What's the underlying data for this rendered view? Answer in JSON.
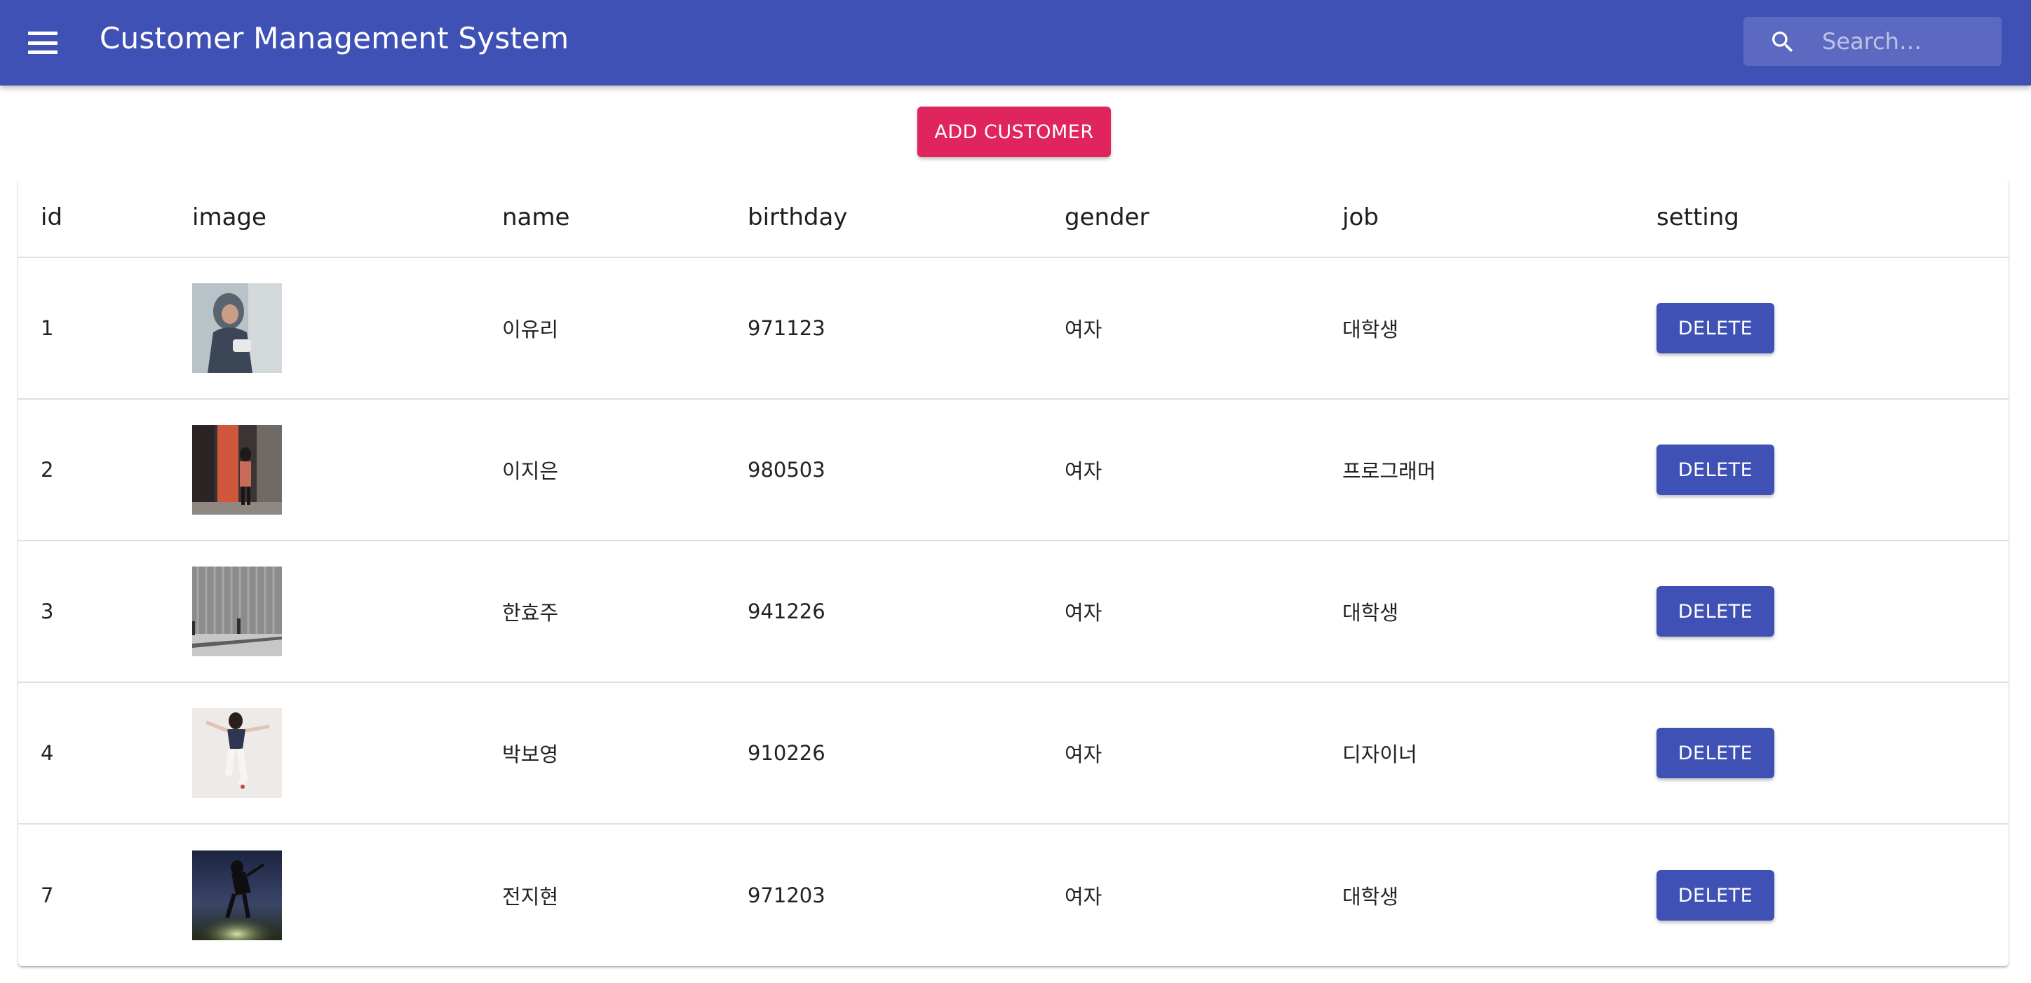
{
  "app": {
    "title": "Customer Management System",
    "search_placeholder": "Search…"
  },
  "actions": {
    "add_label": "ADD CUSTOMER"
  },
  "table": {
    "headers": {
      "id": "id",
      "image": "image",
      "name": "name",
      "birthday": "birthday",
      "gender": "gender",
      "job": "job",
      "setting": "setting"
    },
    "rows": [
      {
        "id": "1",
        "name": "이유리",
        "birthday": "971123",
        "gender": "여자",
        "job": "대학생",
        "delete_label": "DELETE"
      },
      {
        "id": "2",
        "name": "이지은",
        "birthday": "980503",
        "gender": "여자",
        "job": "프로그래머",
        "delete_label": "DELETE"
      },
      {
        "id": "3",
        "name": "한효주",
        "birthday": "941226",
        "gender": "여자",
        "job": "대학생",
        "delete_label": "DELETE"
      },
      {
        "id": "4",
        "name": "박보영",
        "birthday": "910226",
        "gender": "여자",
        "job": "디자이너",
        "delete_label": "DELETE"
      },
      {
        "id": "7",
        "name": "전지현",
        "birthday": "971203",
        "gender": "여자",
        "job": "대학생",
        "delete_label": "DELETE"
      }
    ]
  },
  "colors": {
    "primary": "#3f51b5",
    "accent": "#e0245e"
  }
}
